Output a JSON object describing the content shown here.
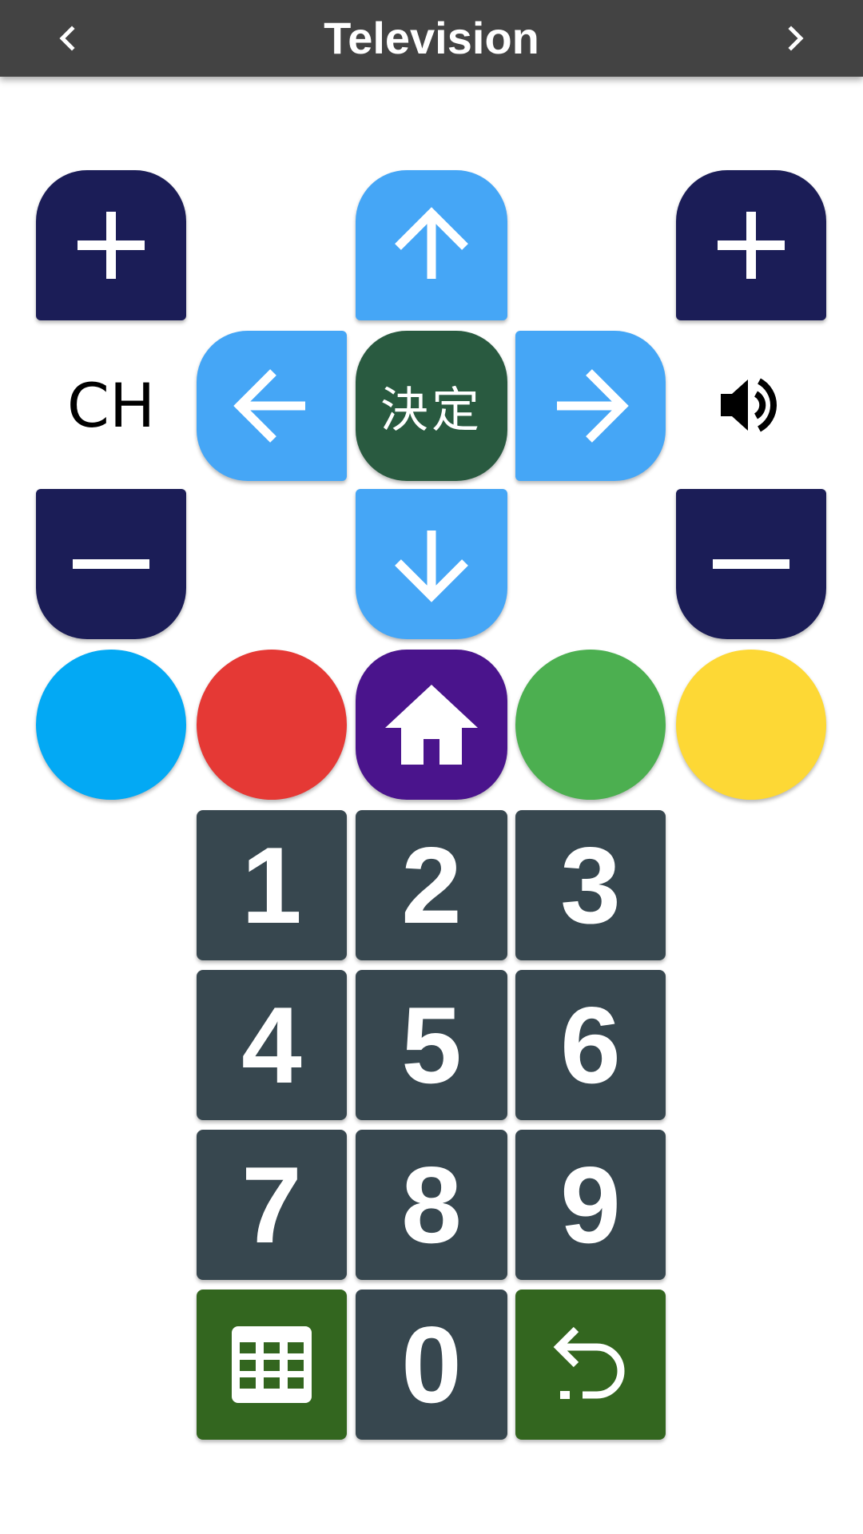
{
  "app": {
    "title": "Television",
    "prev_icon": "chevron-left-icon",
    "next_icon": "chevron-right-icon"
  },
  "channel": {
    "label": "CH",
    "up_icon": "plus-icon",
    "down_icon": "minus-icon"
  },
  "volume": {
    "icon": "speaker-icon",
    "up_icon": "plus-icon",
    "down_icon": "minus-icon"
  },
  "dpad": {
    "ok_label": "決定",
    "up_icon": "arrow-up-icon",
    "down_icon": "arrow-down-icon",
    "left_icon": "arrow-left-icon",
    "right_icon": "arrow-right-icon"
  },
  "color_buttons": [
    {
      "name": "blue",
      "color": "#03a9f4"
    },
    {
      "name": "red",
      "color": "#e53935"
    },
    {
      "name": "green",
      "color": "#4caf50"
    },
    {
      "name": "yellow",
      "color": "#fdd835"
    }
  ],
  "home": {
    "icon": "home-icon",
    "color": "#4a148c"
  },
  "keypad": {
    "digits": [
      "1",
      "2",
      "3",
      "4",
      "5",
      "6",
      "7",
      "8",
      "9",
      "0"
    ],
    "guide_icon": "grid-icon",
    "back_icon": "return-icon"
  },
  "colors": {
    "topbar": "#434343",
    "navy": "#1b1d57",
    "dpad_blue": "#45a6f6",
    "ok_green": "#295a40",
    "key_slate": "#37474f",
    "func_green": "#33661f"
  }
}
